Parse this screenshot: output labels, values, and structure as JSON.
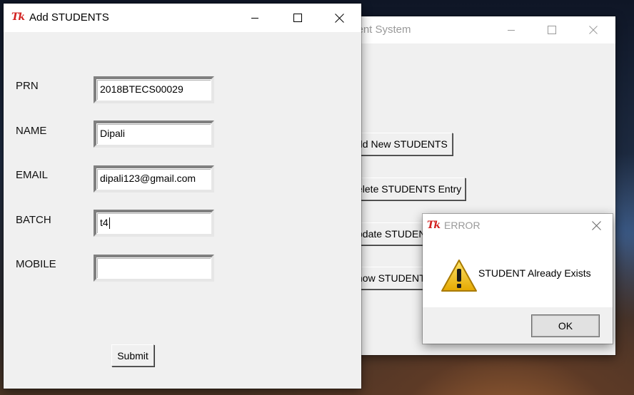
{
  "main_window": {
    "title": "ment System",
    "buttons": [
      {
        "label": "dd New STUDENTS"
      },
      {
        "label": "elete STUDENTS Entry"
      },
      {
        "label": "pdate STUDEN"
      },
      {
        "label": "how STUDENT"
      }
    ]
  },
  "add_window": {
    "logo": "Tk",
    "title": "Add STUDENTS",
    "fields": [
      {
        "label": "PRN",
        "value": "2018BTECS00029"
      },
      {
        "label": "NAME",
        "value": "Dipali"
      },
      {
        "label": "EMAIL",
        "value": "dipali123@gmail.com"
      },
      {
        "label": "BATCH",
        "value": "t4"
      },
      {
        "label": "MOBILE",
        "value": ""
      }
    ],
    "submit_label": "Submit",
    "focused_field": "BATCH"
  },
  "error_dialog": {
    "logo": "Tk",
    "title": "ERROR",
    "message": "STUDENT Already Exists",
    "ok_label": "OK",
    "icon": "warning-icon"
  },
  "colors": {
    "tk_logo": "#d2201f",
    "window_bg": "#f0f0f0",
    "warning_yellow": "#f6c915"
  }
}
